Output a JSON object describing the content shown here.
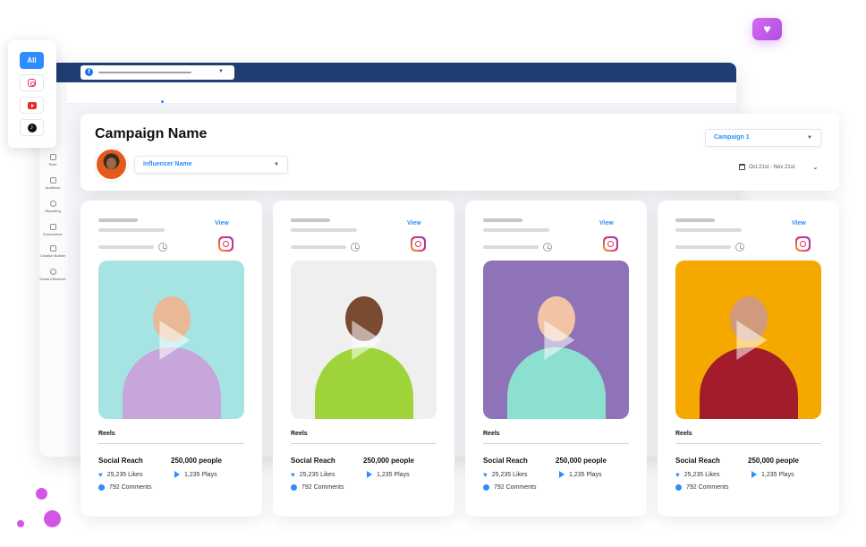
{
  "filters": {
    "all_label": "All"
  },
  "header": {
    "title": "Campaign Name",
    "influencer_select": "Influencer Name",
    "campaign_select": "Campaign 1",
    "date_range": "Oct 21st - Nov 21st"
  },
  "sidebar": {
    "items": [
      {
        "label": "Pixel"
      },
      {
        "label": "Audience"
      },
      {
        "label": "Reporting"
      },
      {
        "label": "Ecommerce"
      },
      {
        "label": "Creative Builder"
      },
      {
        "label": "Social Influencer"
      }
    ]
  },
  "posts": [
    {
      "view": "View",
      "type": "Reels",
      "reach_label": "Social Reach",
      "reach_value": "250,000 people",
      "likes": "25,235 Likes",
      "plays": "1,235 Plays",
      "comments": "792 Comments",
      "bg": "#a6e3e3"
    },
    {
      "view": "View",
      "type": "Reels",
      "reach_label": "Social Reach",
      "reach_value": "250,000 people",
      "likes": "25,235 Likes",
      "plays": "1,235 Plays",
      "comments": "792 Comments",
      "bg": "#efefef"
    },
    {
      "view": "View",
      "type": "Reels",
      "reach_label": "Social Reach",
      "reach_value": "250,000 people",
      "likes": "25,235 Likes",
      "plays": "1,235 Plays",
      "comments": "792 Comments",
      "bg": "#8f73b8"
    },
    {
      "view": "View",
      "type": "Reels",
      "reach_label": "Social Reach",
      "reach_value": "250,000 people",
      "likes": "25,235 Likes",
      "plays": "1,235 Plays",
      "comments": "792 Comments",
      "bg": "#f5a800"
    }
  ],
  "colors": {
    "accent": "#2d8cff",
    "browser_bar": "#1f3e74",
    "brand_purple": "#c55ae8"
  }
}
